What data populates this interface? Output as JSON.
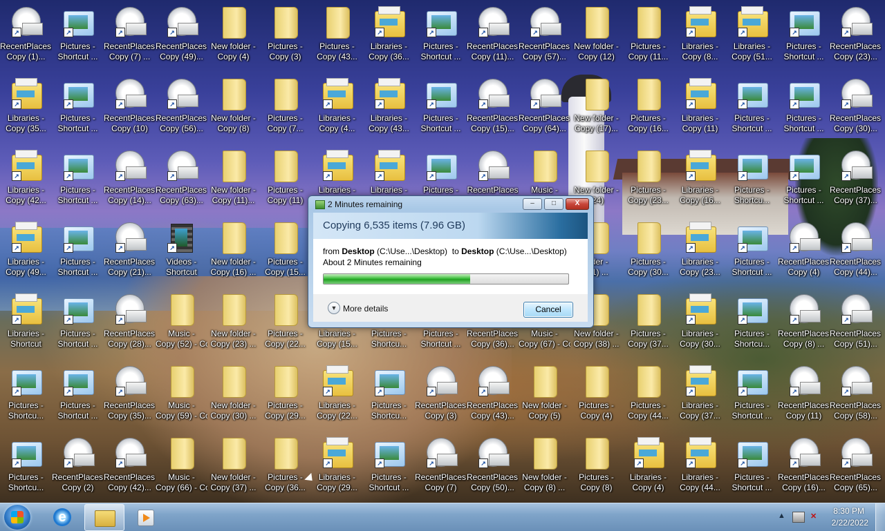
{
  "desktop": {
    "icons": [
      {
        "label": "RecentPlaces - Copy (1)...",
        "type": "recent"
      },
      {
        "label": "Pictures - Shortcut ...",
        "type": "pictures"
      },
      {
        "label": "RecentPlaces - Copy (7) ...",
        "type": "recent"
      },
      {
        "label": "RecentPlaces - Copy (49)...",
        "type": "recent"
      },
      {
        "label": "New folder - Copy (4)",
        "type": "folder"
      },
      {
        "label": "Pictures - Copy (3)",
        "type": "folder"
      },
      {
        "label": "Pictures - Copy (43...",
        "type": "folder"
      },
      {
        "label": "Libraries - Copy (36...",
        "type": "library"
      },
      {
        "label": "Pictures - Shortcut ...",
        "type": "pictures"
      },
      {
        "label": "RecentPlaces - Copy (11)...",
        "type": "recent"
      },
      {
        "label": "RecentPlaces - Copy (57)...",
        "type": "recent"
      },
      {
        "label": "New folder - Copy (12)",
        "type": "folder"
      },
      {
        "label": "Pictures - Copy (11...",
        "type": "folder"
      },
      {
        "label": "Libraries - Copy (8...",
        "type": "library"
      },
      {
        "label": "Libraries - Copy (51...",
        "type": "library"
      },
      {
        "label": "Pictures - Shortcut ...",
        "type": "pictures"
      },
      {
        "label": "RecentPlaces - Copy (23)...",
        "type": "recent"
      },
      {
        "label": "Libraries - Copy (35...",
        "type": "library"
      },
      {
        "label": "Pictures - Shortcut ...",
        "type": "pictures"
      },
      {
        "label": "RecentPlaces - Copy (10)",
        "type": "recent"
      },
      {
        "label": "RecentPlaces - Copy (56)...",
        "type": "recent"
      },
      {
        "label": "New folder - Copy (8)",
        "type": "folder"
      },
      {
        "label": "Pictures - Copy (7...",
        "type": "folder"
      },
      {
        "label": "Libraries - Copy (4...",
        "type": "library"
      },
      {
        "label": "Libraries - Copy (43...",
        "type": "library"
      },
      {
        "label": "Pictures - Shortcut ...",
        "type": "pictures"
      },
      {
        "label": "RecentPlaces - Copy (15)...",
        "type": "recent"
      },
      {
        "label": "RecentPlaces - Copy (64)...",
        "type": "recent"
      },
      {
        "label": "New folder - Copy (17)...",
        "type": "folder"
      },
      {
        "label": "Pictures - Copy (16...",
        "type": "folder"
      },
      {
        "label": "Libraries - Copy (11)",
        "type": "library"
      },
      {
        "label": "Pictures - Shortcut ...",
        "type": "pictures"
      },
      {
        "label": "Pictures - Shortcut ...",
        "type": "pictures"
      },
      {
        "label": "RecentPlaces - Copy (30)...",
        "type": "recent"
      },
      {
        "label": "Libraries - Copy (42...",
        "type": "library"
      },
      {
        "label": "Pictures - Shortcut ...",
        "type": "pictures"
      },
      {
        "label": "RecentPlaces - Copy (14)...",
        "type": "recent"
      },
      {
        "label": "RecentPlaces - Copy (63)...",
        "type": "recent"
      },
      {
        "label": "New folder - Copy (11)...",
        "type": "folder"
      },
      {
        "label": "Pictures - Copy (11)",
        "type": "folder"
      },
      {
        "label": "Libraries - ",
        "type": "library"
      },
      {
        "label": "Libraries - ",
        "type": "library"
      },
      {
        "label": "Pictures - ",
        "type": "pictures"
      },
      {
        "label": "RecentPlaces",
        "type": "recent"
      },
      {
        "label": "Music - Copy",
        "type": "folder"
      },
      {
        "label": "New folder - (24)",
        "type": "folder"
      },
      {
        "label": "Pictures - Copy (23...",
        "type": "folder"
      },
      {
        "label": "Libraries - Copy (16...",
        "type": "library"
      },
      {
        "label": "Pictures - Shortcu...",
        "type": "pictures"
      },
      {
        "label": "Pictures - Shortcut ...",
        "type": "pictures"
      },
      {
        "label": "RecentPlaces - Copy (37)...",
        "type": "recent"
      },
      {
        "label": "Libraries - Copy (49...",
        "type": "library"
      },
      {
        "label": "Pictures - Shortcut ...",
        "type": "pictures"
      },
      {
        "label": "RecentPlaces - Copy (21)...",
        "type": "recent"
      },
      {
        "label": "Videos - Shortcut",
        "type": "video"
      },
      {
        "label": "New folder - Copy (16) ...",
        "type": "folder"
      },
      {
        "label": "Pictures - Copy (15...",
        "type": "folder"
      },
      {
        "label": "older - (31) ...",
        "type": "folder"
      },
      {
        "label": "Pictures - Copy (30...",
        "type": "folder"
      },
      {
        "label": "Libraries - Copy (23...",
        "type": "library"
      },
      {
        "label": "Pictures - Shortcut ...",
        "type": "pictures"
      },
      {
        "label": "RecentPlaces - Copy (4)",
        "type": "recent"
      },
      {
        "label": "RecentPlaces - Copy (44)...",
        "type": "recent"
      },
      {
        "label": "Libraries - Shortcut",
        "type": "library"
      },
      {
        "label": "Pictures - Shortcut ...",
        "type": "pictures"
      },
      {
        "label": "RecentPlaces - Copy (28)...",
        "type": "recent"
      },
      {
        "label": "Music - Copy (52) - Copy",
        "type": "folder"
      },
      {
        "label": "New folder - Copy (23) ...",
        "type": "folder"
      },
      {
        "label": "Pictures - Copy (22...",
        "type": "folder"
      },
      {
        "label": "Libraries - Copy (15...",
        "type": "library"
      },
      {
        "label": "Pictures - Shortcu...",
        "type": "pictures"
      },
      {
        "label": "Pictures - Shortcut ...",
        "type": "pictures"
      },
      {
        "label": "RecentPlaces - Copy (36)...",
        "type": "recent"
      },
      {
        "label": "Music - Copy (67) - Copy",
        "type": "folder"
      },
      {
        "label": "New folder - Copy (38) ...",
        "type": "folder"
      },
      {
        "label": "Pictures - Copy (37...",
        "type": "folder"
      },
      {
        "label": "Libraries - Copy (30...",
        "type": "library"
      },
      {
        "label": "Pictures - Shortcu...",
        "type": "pictures"
      },
      {
        "label": "RecentPlaces - Copy (8) ...",
        "type": "recent"
      },
      {
        "label": "RecentPlaces - Copy (51)...",
        "type": "recent"
      },
      {
        "label": "Pictures - Shortcu...",
        "type": "pictures"
      },
      {
        "label": "Pictures - Shortcut ...",
        "type": "pictures"
      },
      {
        "label": "RecentPlaces - Copy (35)...",
        "type": "recent"
      },
      {
        "label": "Music - Copy (59) - Copy",
        "type": "folder"
      },
      {
        "label": "New folder - Copy (30) ...",
        "type": "folder"
      },
      {
        "label": "Pictures - Copy (29...",
        "type": "folder"
      },
      {
        "label": "Libraries - Copy (22...",
        "type": "library"
      },
      {
        "label": "Pictures - Shortcu...",
        "type": "pictures"
      },
      {
        "label": "RecentPlaces - Copy (3)",
        "type": "recent"
      },
      {
        "label": "RecentPlaces - Copy (43)...",
        "type": "recent"
      },
      {
        "label": "New folder - Copy (5)",
        "type": "folder"
      },
      {
        "label": "Pictures - Copy (4)",
        "type": "folder"
      },
      {
        "label": "Pictures - Copy (44...",
        "type": "folder"
      },
      {
        "label": "Libraries - Copy (37...",
        "type": "library"
      },
      {
        "label": "Pictures - Shortcut ...",
        "type": "pictures"
      },
      {
        "label": "RecentPlaces - Copy (11)",
        "type": "recent"
      },
      {
        "label": "RecentPlaces - Copy (58)...",
        "type": "recent"
      },
      {
        "label": "Pictures - Shortcu...",
        "type": "pictures"
      },
      {
        "label": "RecentPlaces - Copy (2)",
        "type": "recent"
      },
      {
        "label": "RecentPlaces - Copy (42)...",
        "type": "recent"
      },
      {
        "label": "Music - Copy (66) - Copy",
        "type": "folder"
      },
      {
        "label": "New folder - Copy (37) ...",
        "type": "folder"
      },
      {
        "label": "Pictures - Copy (36...",
        "type": "folder"
      },
      {
        "label": "Libraries - Copy (29...",
        "type": "library"
      },
      {
        "label": "Pictures - Shortcut ...",
        "type": "pictures"
      },
      {
        "label": "RecentPlaces - Copy (7)",
        "type": "recent"
      },
      {
        "label": "RecentPlaces - Copy (50)...",
        "type": "recent"
      },
      {
        "label": "New folder - Copy (8) ...",
        "type": "folder"
      },
      {
        "label": "Pictures - Copy (8)",
        "type": "folder"
      },
      {
        "label": "Libraries - Copy (4)",
        "type": "library"
      },
      {
        "label": "Libraries - Copy (44...",
        "type": "library"
      },
      {
        "label": "Pictures - Shortcut ...",
        "type": "pictures"
      },
      {
        "label": "RecentPlaces - Copy (16)...",
        "type": "recent"
      },
      {
        "label": "RecentPlaces - Copy (65)...",
        "type": "recent"
      }
    ]
  },
  "dialog": {
    "title": "2 Minutes remaining",
    "heading": "Copying 6,535 items (7.96 GB)",
    "from_word": "from",
    "from_name": "Desktop",
    "from_path": "(C:\\Use...\\Desktop)",
    "to_word": "to",
    "to_name": "Desktop",
    "to_path": "(C:\\Use...\\Desktop)",
    "remaining": "About 2 Minutes remaining",
    "progress_percent": 60,
    "more_details": "More details",
    "cancel": "Cancel",
    "minimize": "–",
    "maximize": "□",
    "close": "X"
  },
  "taskbar": {
    "clock_time": "8:30 PM",
    "clock_date": "2/22/2022",
    "ie_glyph": "e",
    "tray_up": "▲"
  },
  "colors": {
    "progress": "#2aa82a",
    "taskbar": "#7fa4c9",
    "accent": "#3c7fb1"
  }
}
